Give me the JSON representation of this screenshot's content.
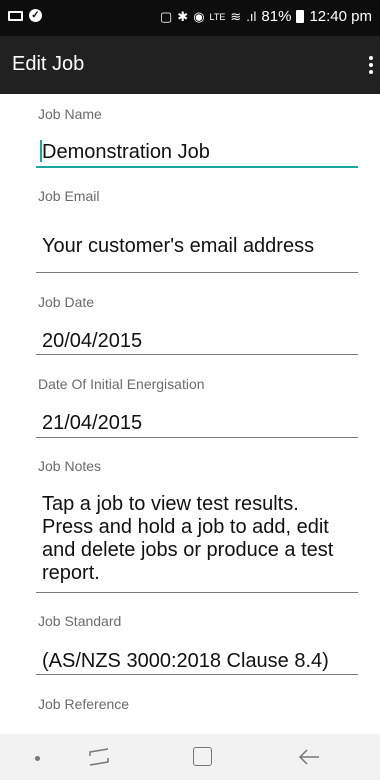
{
  "status_bar": {
    "network_label": "LTE",
    "battery_text": "81%",
    "time": "12:40 pm"
  },
  "app_bar": {
    "title": "Edit Job",
    "menu_icon": "overflow-menu-icon"
  },
  "fields": {
    "job_name": {
      "label": "Job Name",
      "value": "Demonstration Job"
    },
    "job_email": {
      "label": "Job Email",
      "placeholder": "Your customer's email address"
    },
    "job_date": {
      "label": "Job Date",
      "value": "20/04/2015"
    },
    "initial_energisation": {
      "label": "Date Of Initial Energisation",
      "value": "21/04/2015"
    },
    "job_notes": {
      "label": "Job Notes",
      "lines": [
        "Tap a job to view test results.",
        "Press and hold a job to add, edit",
        "and delete jobs or produce a test",
        "report."
      ]
    },
    "job_standard": {
      "label": "Job Standard",
      "value": "(AS/NZS 3000:2018 Clause 8.4)"
    },
    "job_reference": {
      "label": "Job Reference"
    }
  },
  "colors": {
    "status_bar": "#0d0d0d",
    "app_bar": "#212121",
    "accent": "#1aa89c",
    "label": "#6b6b6b"
  },
  "nav_bar": {
    "icons": [
      "nav-dot-icon",
      "recent-apps-icon",
      "home-icon",
      "back-icon"
    ]
  }
}
